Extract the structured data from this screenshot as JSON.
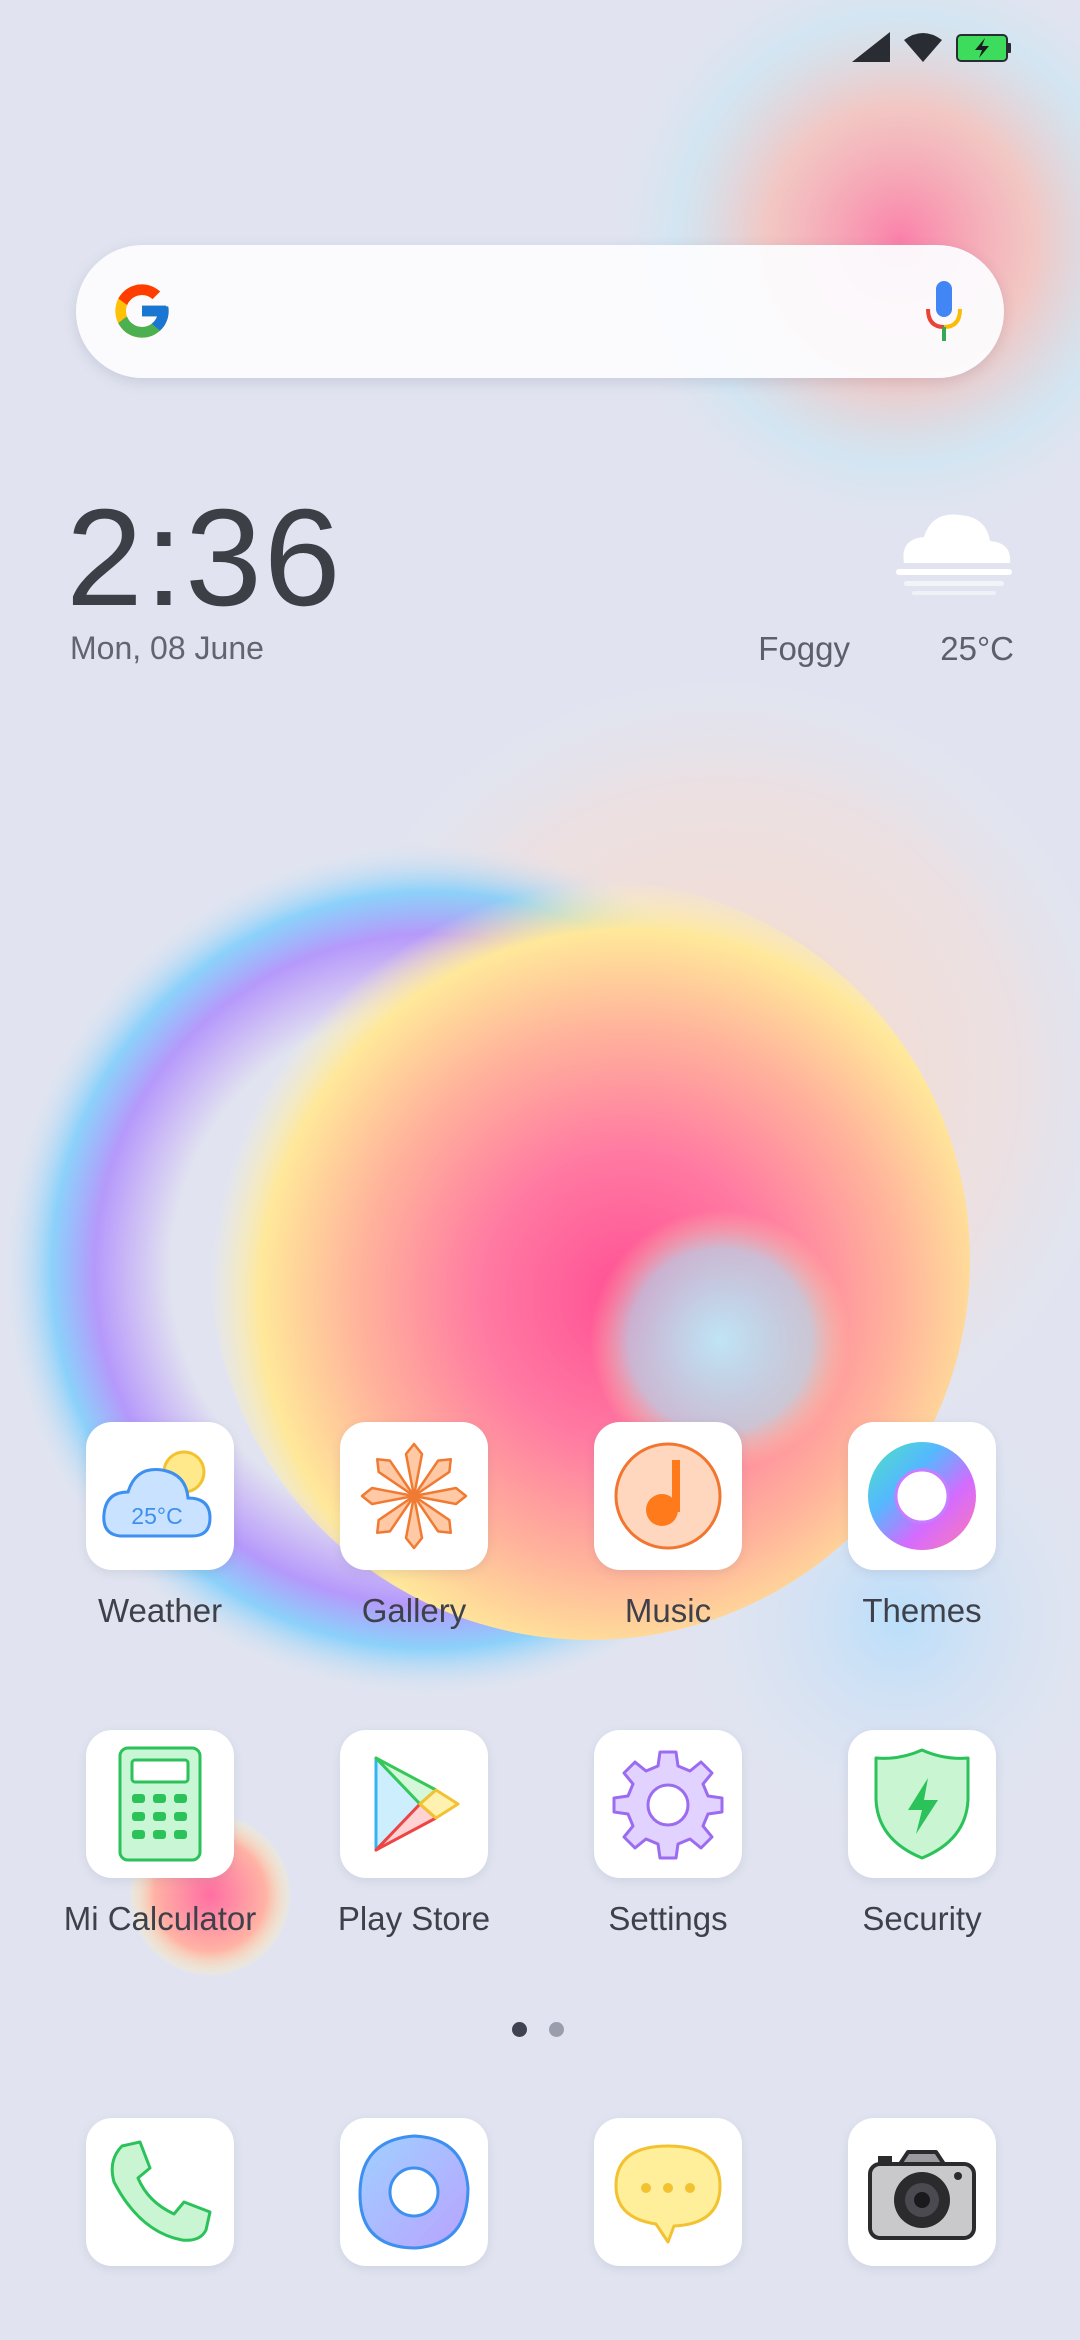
{
  "status_bar": {
    "icons": [
      "signal-icon",
      "wifi-icon",
      "battery-charging-icon"
    ],
    "battery_color": "#3ddc5c"
  },
  "search_bar": {
    "logo": "google-logo-icon",
    "mic_icon": "mic-icon"
  },
  "clock_widget": {
    "time": "2:36",
    "date": "Mon, 08 June"
  },
  "weather_widget": {
    "icon": "fog-cloud-icon",
    "condition": "Foggy",
    "temperature": "25°C"
  },
  "home_apps": [
    {
      "label": "Weather",
      "icon": "weather-icon",
      "badge_text": "25°C"
    },
    {
      "label": "Gallery",
      "icon": "gallery-flower-icon"
    },
    {
      "label": "Music",
      "icon": "music-note-icon"
    },
    {
      "label": "Themes",
      "icon": "themes-ring-icon"
    },
    {
      "label": "Mi Calculator",
      "icon": "calculator-icon"
    },
    {
      "label": "Play Store",
      "icon": "play-store-icon"
    },
    {
      "label": "Settings",
      "icon": "gear-icon"
    },
    {
      "label": "Security",
      "icon": "shield-bolt-icon"
    }
  ],
  "page_indicator": {
    "total_pages": 2,
    "active_page": 1,
    "active_color": "#3f4250",
    "inactive_color": "#9a9dab"
  },
  "dock_apps": [
    {
      "icon": "phone-icon"
    },
    {
      "icon": "browser-icon"
    },
    {
      "icon": "messaging-icon"
    },
    {
      "icon": "camera-icon"
    }
  ],
  "colors": {
    "background": "#e1e4f0",
    "label_text": "#3e414a",
    "accent_pink": "#ff5c9a"
  }
}
